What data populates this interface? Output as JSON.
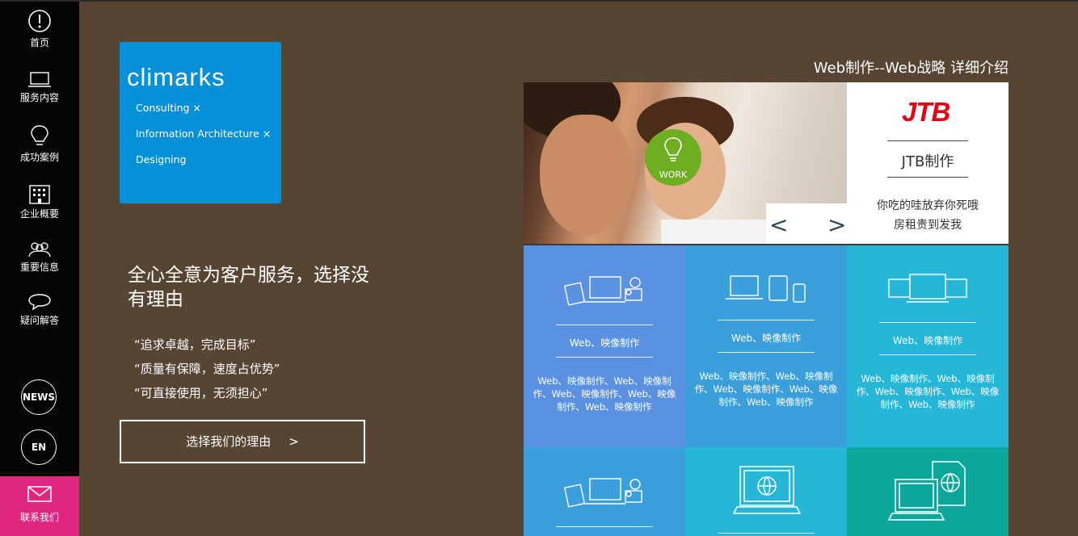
{
  "colors": {
    "sidebar": "#050505",
    "main_bg": "#574533",
    "logo_blue": "#0690d8",
    "contact_pink": "#e0267d",
    "work_green": "#6fae22",
    "jtb_red": "#e60012"
  },
  "sidebar": {
    "items": [
      {
        "label": "首页",
        "icon": "exclamation-icon"
      },
      {
        "label": "服务内容",
        "icon": "laptop-icon"
      },
      {
        "label": "成功案例",
        "icon": "lightbulb-icon"
      },
      {
        "label": "企业概要",
        "icon": "building-icon"
      },
      {
        "label": "重要信息",
        "icon": "people-icon"
      },
      {
        "label": "疑问解答",
        "icon": "speech-bubble-icon"
      }
    ],
    "news": "NEWS",
    "lang": "EN",
    "contact": {
      "label": "联系我们",
      "icon": "envelope-icon"
    }
  },
  "logo": {
    "text": "climarks",
    "lines": [
      "Consulting ×",
      "Information Architecture ×",
      "Designing"
    ]
  },
  "hero": {
    "headline": "全心全意为客户服务，选择没有理由",
    "quotes": [
      "“追求卓越，完成目标”",
      "“质量有保障，速度占优势”",
      "“可直接使用，无须担心”"
    ],
    "button": "选择我们的理由",
    "button_arrow": ">"
  },
  "section_title": "Web制作--Web战略 详细介绍",
  "slider": {
    "badge": "WORK",
    "prev": "<",
    "next": ">"
  },
  "case": {
    "logo": "JTB",
    "title": "JTB制作",
    "desc_line1": "你吃的哇放弃你死哦",
    "desc_line2": "房租贵到发我"
  },
  "tiles": [
    {
      "label": "Web、映像制作",
      "desc": "Web、映像制作、Web、映像制作、Web、映像制作、Web、映像制作、Web、映像制作",
      "color": "#5a91e0",
      "icon": "devices-media-icon"
    },
    {
      "label": "Web、映像制作",
      "desc": "Web、映像制作、Web、映像制作、Web、映像制作、Web、映像制作、Web、映像制作",
      "color": "#3b9fdc",
      "icon": "responsive-devices-icon"
    },
    {
      "label": "Web、映像制作",
      "desc": "Web、映像制作、Web、映像制作、Web、映像制作、Web、映像制作、Web、映像制作",
      "color": "#26b6d8",
      "icon": "multi-screen-icon"
    },
    {
      "color": "#3b9fdc",
      "icon": "devices-media-icon"
    },
    {
      "color": "#26b6d8",
      "icon": "globe-laptop-icon"
    },
    {
      "color": "#0aa79a",
      "icon": "globe-document-icon"
    }
  ]
}
